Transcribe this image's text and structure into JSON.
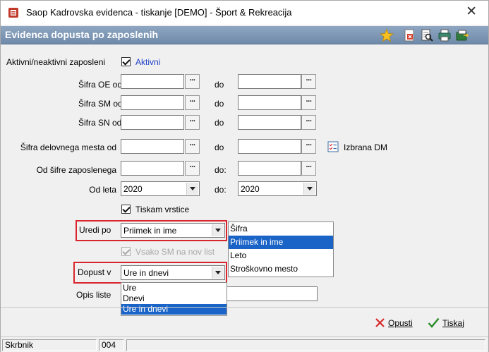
{
  "window": {
    "title": "Saop Kadrovska evidenca  - tiskanje [DEMO] - Šport & Rekreacija",
    "close_glyph": "✕"
  },
  "header": {
    "title": "Evidenca dopusta po zaposlenih",
    "toolbar_icons": [
      "star-icon",
      "delete-document-icon",
      "print-preview-icon",
      "printer-icon",
      "export-icon"
    ]
  },
  "form": {
    "active_label": "Aktivni/neaktivni zaposleni",
    "active_value": "Aktivni",
    "active_checked": true,
    "sifra_oe_label": "Šifra OE od",
    "sifra_sm_label": "Šifra SM od",
    "sifra_sn_label": "Šifra SN od",
    "delovno_mesto_label": "Šifra delovnega mesta od",
    "od_sifre_label": "Od šifre zaposlenega",
    "od_leta_label": "Od leta",
    "do_label": "do",
    "do_colon_label": "do:",
    "dots": "···",
    "od_leta_value": "2020",
    "do_leta_value": "2020",
    "izbrana_dm_label": "Izbrana DM",
    "tiskam_vrstice_label": "Tiskam vrstice",
    "tiskam_vrstice_checked": true,
    "uredi_po_label": "Uredi po",
    "uredi_po_value": "Priimek in ime",
    "vsako_sm_label": "Vsako SM na nov list",
    "dopust_v_label": "Dopust v",
    "dopust_v_value": "Ure in dnevi",
    "opis_liste_label": "Opis liste"
  },
  "uredi_po_options": [
    {
      "label": "Šifra",
      "selected": false
    },
    {
      "label": "Priimek in ime",
      "selected": true
    },
    {
      "label": "Leto",
      "selected": false
    },
    {
      "label": "Stroškovno mesto",
      "selected": false
    }
  ],
  "dopust_v_options": [
    {
      "label": "Ure",
      "selected": false
    },
    {
      "label": "Dnevi",
      "selected": false
    },
    {
      "label": "Ure in dnevi",
      "selected": true
    }
  ],
  "buttons": {
    "opusti": "Opusti",
    "tiskaj": "Tiskaj"
  },
  "statusbar": {
    "user": "Skrbnik",
    "code": "004"
  },
  "colors": {
    "accent_red": "#d9262e",
    "selection_blue": "#1a64c8",
    "header_blue": "#7d97b6"
  }
}
